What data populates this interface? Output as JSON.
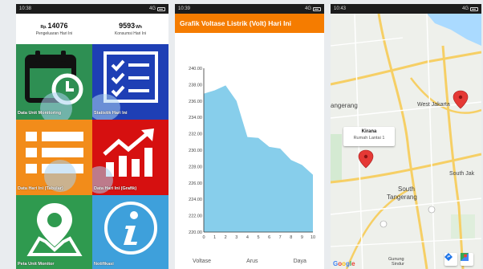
{
  "screen1": {
    "status": {
      "time": "10:38",
      "signal": "4G"
    },
    "summary": [
      {
        "currency": "Rp.",
        "value": "14076",
        "unit": "",
        "label": "Pengeluaran Hari Ini"
      },
      {
        "currency": "",
        "value": "9593",
        "unit": "Wh",
        "label": "Konsumsi Hari Ini"
      }
    ],
    "tiles": [
      {
        "label": "Data Unit Monitoring",
        "icon": "calendar-clock-icon",
        "color": "#2e8f53"
      },
      {
        "label": "Statistik Hari Ini",
        "icon": "checklist-icon",
        "color": "#1e3fb5"
      },
      {
        "label": "Data Hari Ini (Tabular)",
        "icon": "list-table-icon",
        "color": "#f28c1a"
      },
      {
        "label": "Data Hari Ini (Grafik)",
        "icon": "growth-chart-icon",
        "color": "#d61010"
      },
      {
        "label": "Peta Unit Monitor",
        "icon": "map-pin-icon",
        "color": "#2f9a4f"
      },
      {
        "label": "Notifikasi",
        "icon": "info-icon",
        "color": "#3ea0db"
      }
    ]
  },
  "screen2": {
    "status": {
      "time": "10:39",
      "signal": "4G"
    },
    "title": "Grafik Voltase Listrik (Volt) Hari Ini",
    "tabs": [
      "Voltase",
      "Arus",
      "Daya"
    ],
    "chart_data": {
      "type": "area",
      "title": "Grafik Voltase Listrik (Volt) Hari Ini",
      "x": [
        0,
        1,
        2,
        3,
        4,
        5,
        6,
        7,
        8,
        9,
        10
      ],
      "values": [
        236.9,
        237.3,
        237.9,
        236.0,
        231.6,
        231.5,
        230.4,
        230.2,
        228.8,
        228.2,
        227.0
      ],
      "x_ticks": [
        "0",
        "1",
        "2",
        "3",
        "4",
        "5",
        "6",
        "7",
        "8",
        "9",
        "10"
      ],
      "y_ticks": [
        "220.00",
        "222.00",
        "224.00",
        "226.00",
        "228.00",
        "230.00",
        "232.00",
        "234.00",
        "236.00",
        "238.00",
        "240.00"
      ],
      "xlim": [
        0,
        10
      ],
      "ylim": [
        220,
        240
      ],
      "fill_color": "#87ceeb",
      "grid": false
    }
  },
  "screen3": {
    "status": {
      "time": "10:43",
      "signal": "4G"
    },
    "labels": {
      "tangerang": "angerang",
      "west_jakarta": "West Jakarta",
      "south_tangerang_1": "South",
      "south_tangerang_2": "Tangerang",
      "south_jak": "South Jak",
      "gunung_sindur_1": "Gunung",
      "gunung_sindur_2": "Sindur",
      "google": "Google"
    },
    "infowindow": {
      "title": "Kirana",
      "subtitle": "Rumah Lantai 1"
    },
    "marker_color": "#e53935"
  }
}
